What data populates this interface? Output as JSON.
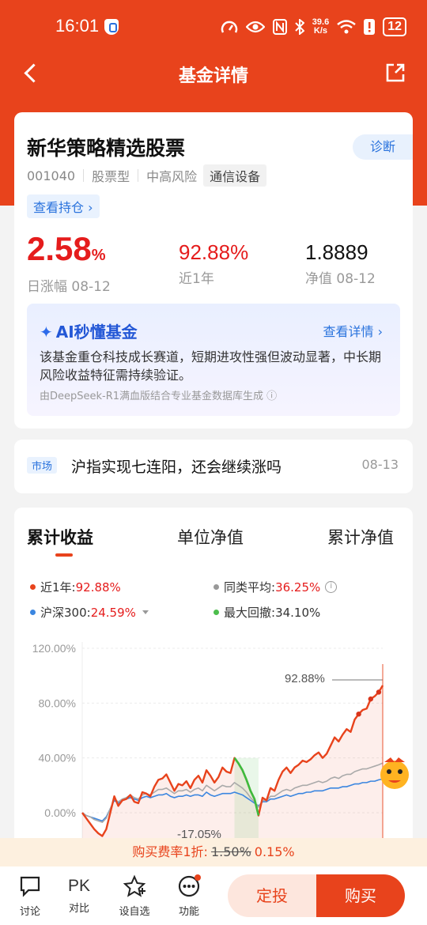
{
  "status": {
    "time": "16:01",
    "speed_top": "39.6",
    "speed_bottom": "K/s",
    "battery": "12"
  },
  "nav": {
    "title": "基金详情"
  },
  "fund": {
    "name": "新华策略精选股票",
    "code": "001040",
    "type": "股票型",
    "risk": "中高风险",
    "industry": "通信设备",
    "diag_label": "诊断",
    "holdings_label": "查看持仓",
    "daily_change": "2.58",
    "daily_change_pct": "%",
    "daily_change_label": "日涨幅 08-12",
    "year_return": "92.88%",
    "year_return_label": "近1年",
    "nav_value": "1.8889",
    "nav_label": "净值 08-12"
  },
  "ai": {
    "title": "AI秒懂基金",
    "link": "查看详情",
    "text": "该基金重仓科技成长赛道，短期进攻性强但波动显著，中长期风险收益特征需持续验证。",
    "note": "由DeepSeek-R1满血版结合专业基金数据库生成"
  },
  "news": {
    "tag": "市场",
    "title": "沪指实现七连阳，还会继续涨吗",
    "date": "08-13"
  },
  "chart_tabs": [
    "累计收益",
    "单位净值",
    "累计净值"
  ],
  "legend": {
    "fund_label": "近1年:",
    "fund_value": "92.88%",
    "peer_label": "同类平均:",
    "peer_value": "36.25%",
    "index_label": "沪深300:",
    "index_value": "24.59%",
    "drawdown_label": "最大回撤:",
    "drawdown_value": "34.10%"
  },
  "chart_data": {
    "type": "line",
    "y_ticks": [
      "120.00%",
      "80.00%",
      "40.00%",
      "0.00%"
    ],
    "ylim": [
      -20,
      120
    ],
    "end_label": "92.88%",
    "trough_label": "-17.05%",
    "series": [
      {
        "name": "近1年",
        "color": "#e8431c",
        "end_value": 92.88,
        "values": [
          0,
          -4,
          -8,
          -12,
          -15,
          -17,
          -12,
          0,
          12,
          5,
          9,
          10,
          13,
          8,
          7,
          15,
          14,
          12,
          19,
          24,
          25,
          28,
          22,
          16,
          21,
          20,
          23,
          18,
          24,
          27,
          22,
          31,
          27,
          22,
          26,
          33,
          30,
          29,
          40,
          36,
          31,
          24,
          16,
          10,
          -2,
          11,
          9,
          18,
          16,
          24,
          30,
          33,
          29,
          33,
          35,
          38,
          37,
          39,
          42,
          44,
          40,
          43,
          49,
          55,
          52,
          57,
          61,
          59,
          68,
          72,
          75,
          76,
          83,
          85,
          88,
          92.88
        ]
      },
      {
        "name": "同类平均",
        "color": "#aaaaaa",
        "end_value": 36.25,
        "values": [
          0,
          -2,
          -3,
          -5,
          -6,
          -7,
          -4,
          3,
          10,
          8,
          10,
          11,
          13,
          11,
          10,
          13,
          14,
          13,
          15,
          17,
          17,
          18,
          16,
          14,
          16,
          16,
          17,
          15,
          17,
          18,
          16,
          20,
          18,
          16,
          18,
          20,
          19,
          19,
          22,
          20,
          18,
          15,
          11,
          8,
          4,
          9,
          9,
          12,
          12,
          14,
          16,
          17,
          16,
          18,
          19,
          20,
          20,
          21,
          22,
          23,
          22,
          23,
          25,
          26,
          25,
          27,
          28,
          28,
          30,
          31,
          32,
          32,
          33,
          34,
          35,
          36.25
        ]
      },
      {
        "name": "沪深300",
        "color": "#3b86e0",
        "end_value": 24.59,
        "values": [
          0,
          -2,
          -3,
          -4,
          -5,
          -6,
          -3,
          3,
          9,
          7,
          9,
          10,
          11,
          10,
          9,
          11,
          12,
          11,
          12,
          13,
          13,
          14,
          12,
          11,
          12,
          12,
          13,
          12,
          13,
          13,
          12,
          15,
          13,
          12,
          13,
          14,
          14,
          14,
          15,
          14,
          13,
          11,
          9,
          7,
          5,
          8,
          8,
          10,
          10,
          11,
          12,
          13,
          12,
          13,
          14,
          14,
          15,
          15,
          16,
          16,
          16,
          17,
          18,
          18,
          18,
          19,
          19,
          20,
          21,
          21,
          22,
          22,
          23,
          23,
          24,
          24.59
        ]
      }
    ],
    "max_drawdown": 34.1
  },
  "fee": {
    "prefix": "购买费率1折:",
    "old": "1.50%",
    "new": "0.15%"
  },
  "bottom": {
    "discuss": "讨论",
    "compare_icon": "PK",
    "compare": "对比",
    "watch": "设自选",
    "more": "功能",
    "dingtou": "定投",
    "buy": "购买"
  }
}
